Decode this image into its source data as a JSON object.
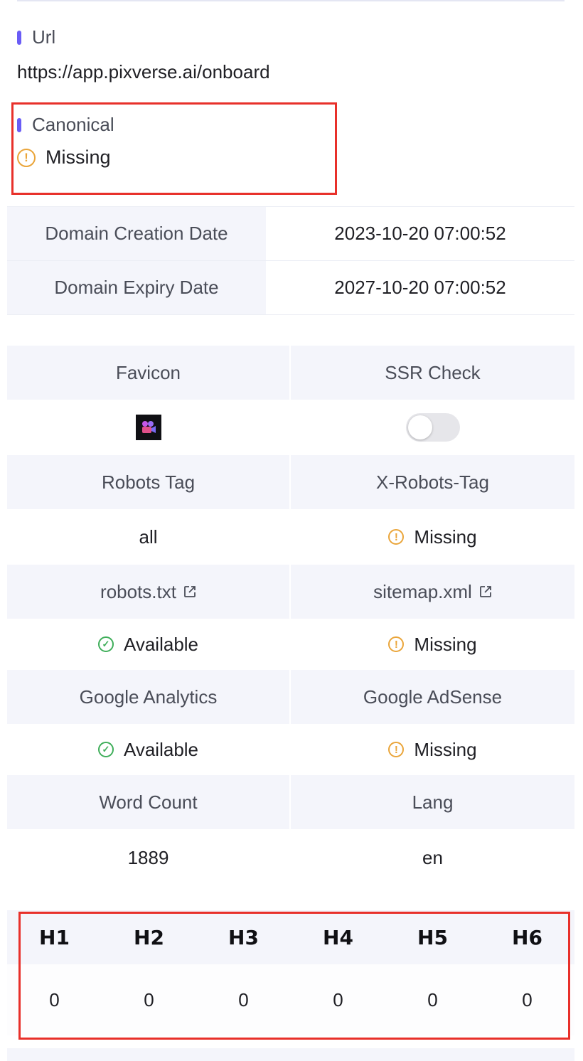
{
  "url_section": {
    "label": "Url",
    "value": "https://app.pixverse.ai/onboard"
  },
  "canonical_section": {
    "label": "Canonical",
    "status": "Missing"
  },
  "domain_dates": [
    {
      "label": "Domain Creation Date",
      "value": "2023-10-20 07:00:52"
    },
    {
      "label": "Domain Expiry Date",
      "value": "2027-10-20 07:00:52"
    }
  ],
  "grid": {
    "favicon_label": "Favicon",
    "ssr_label": "SSR Check",
    "ssr_enabled": false,
    "robots_tag_label": "Robots Tag",
    "robots_tag_value": "all",
    "x_robots_label": "X-Robots-Tag",
    "x_robots_status": "Missing",
    "robots_txt_label": "robots.txt",
    "robots_txt_status": "Available",
    "sitemap_label": "sitemap.xml",
    "sitemap_status": "Missing",
    "ga_label": "Google Analytics",
    "ga_status": "Available",
    "adsense_label": "Google AdSense",
    "adsense_status": "Missing",
    "word_count_label": "Word Count",
    "word_count_value": "1889",
    "lang_label": "Lang",
    "lang_value": "en"
  },
  "headings": {
    "labels": [
      "H1",
      "H2",
      "H3",
      "H4",
      "H5",
      "H6"
    ],
    "counts": [
      "0",
      "0",
      "0",
      "0",
      "0",
      "0"
    ]
  },
  "colors": {
    "accent": "#6a5cf6",
    "warning": "#eaa53a",
    "success": "#3fae5a",
    "highlight_border": "#e8302a",
    "header_bg": "#f4f5fb"
  },
  "icons": {
    "warning": "warning-circle-icon",
    "ok": "check-circle-icon",
    "external": "external-link-icon"
  }
}
